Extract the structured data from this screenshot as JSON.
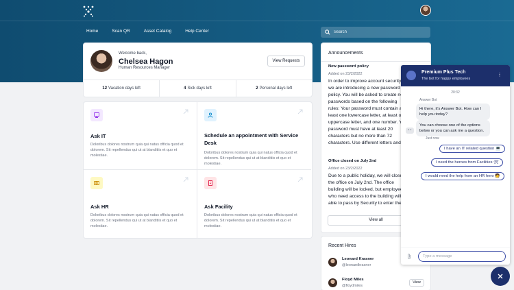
{
  "nav": {
    "items": [
      "Home",
      "Scan QR",
      "Asset Catalog",
      "Help Center"
    ]
  },
  "search": {
    "placeholder": "Search"
  },
  "profile": {
    "welcome": "Welcome back,",
    "name": "Chelsea Hagon",
    "role": "Human Resources Manager",
    "view_requests": "View Requests",
    "stats": [
      {
        "value": "12",
        "label": "Vacation days left"
      },
      {
        "value": "4",
        "label": "Sick days left"
      },
      {
        "value": "2",
        "label": "Personal days left"
      }
    ]
  },
  "tiles": [
    {
      "title": "Ask IT",
      "desc": "Doloribus dolores nostrum quia qui natus officia quod et dolorem. Sit repellendus qui ut at blanditiis et quo et molestiae.",
      "icon": "monitor-icon",
      "color": "#9333ea",
      "bg": "#f3e8ff"
    },
    {
      "title": "Schedule an appointment with Service Desk",
      "desc": "Doloribus dolores nostrum quia qui natus officia quod et dolorem. Sit repellendus qui ut at blanditiis et quo et molestiae.",
      "icon": "users-icon",
      "color": "#0284c7",
      "bg": "#e0f2fe"
    },
    {
      "title": "Ask HR",
      "desc": "Doloribus dolores nostrum quia qui natus officia quod et dolorem. Sit repellendus qui ut at blanditiis et quo et molestiae.",
      "icon": "cash-icon",
      "color": "#ca8a04",
      "bg": "#fef9c3"
    },
    {
      "title": "Ask Facility",
      "desc": "Doloribus dolores nostrum quia qui natus officia quod et dolorem. Sit repellendus qui ut at blanditiis et quo et molestiae.",
      "icon": "building-icon",
      "color": "#e11d48",
      "bg": "#ffe4e6"
    }
  ],
  "announcements": {
    "header": "Announcements",
    "items": [
      {
        "title": "New password policy",
        "date": "Added on 23/2/2022",
        "body": "In order to improve account security, we are introducing a new password policy. You will be asked to create new passwords based on the following rules: Your password must contain at least one lowercase letter, at least one uppercase letter, and one number. Your password must have at least 20 characters but no more than 72 characters. Use different letters and numbers so that it can be easily guessed."
      },
      {
        "title": "Office closed on July 2nd",
        "date": "Added on 23/2/2022",
        "body": "Due to a public holiday, we will close the office on July 2nd. The office building will be locked, but employees who need access to the building will be able to pass by Security to enter the office."
      }
    ],
    "view_all": "View all"
  },
  "hires": {
    "title": "Recent Hires",
    "people": [
      {
        "name": "Leonard Krasner",
        "handle": "@leonardkrasner",
        "view": "View"
      },
      {
        "name": "Floyd Miles",
        "handle": "@floydmiles",
        "view": "View"
      }
    ]
  },
  "chat": {
    "title": "Premium Plus Tech",
    "subtitle": "The bot for happy employees",
    "time": "20:32",
    "bot_name": "Answer Bot",
    "messages": [
      "Hi there, it's Answer Bot. How can I help you today?",
      "You can choose one of the options below or you can ask me a question."
    ],
    "bot_avatar": "• •",
    "just_now": "Just now",
    "quick_replies": [
      "I have an IT related question 💻",
      "I need the heroes from Facilities 🛠",
      "I would need the help from an HR hero 🧑"
    ],
    "input_placeholder": "Type a message"
  },
  "colors": {
    "header_gradient_start": "#0f4c70",
    "header_gradient_end": "#1a6a93",
    "chat_accent": "#1c2f6b"
  }
}
